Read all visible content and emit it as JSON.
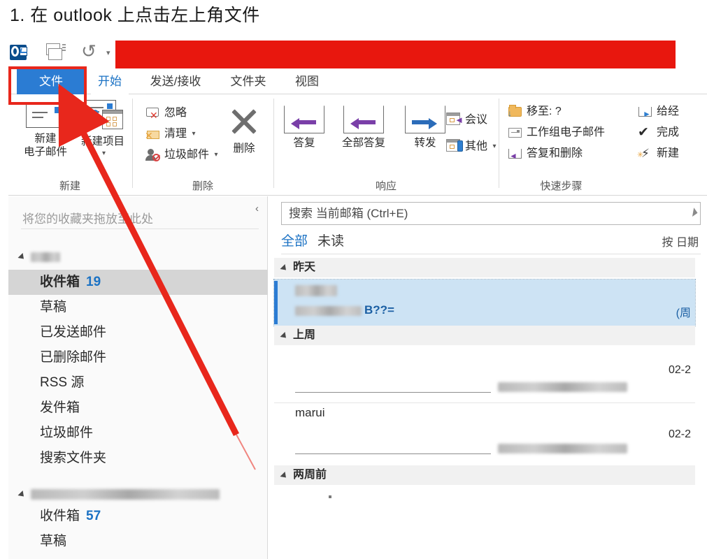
{
  "instruction": {
    "text": "1. 在 outlook 上点击左上角文件"
  },
  "quick_access": {
    "logo": "outlook-logo",
    "send_receive": "send-receive-all-icon",
    "undo": "↺",
    "dropdown": "▾"
  },
  "tabs": [
    {
      "label": "文件",
      "active": false,
      "highlighted": true
    },
    {
      "label": "开始",
      "active": true,
      "highlighted": false
    },
    {
      "label": "发送/接收",
      "active": false,
      "highlighted": false
    },
    {
      "label": "文件夹",
      "active": false,
      "highlighted": false
    },
    {
      "label": "视图",
      "active": false,
      "highlighted": false
    }
  ],
  "ribbon": {
    "groups": [
      {
        "name": "新建",
        "label": "新建",
        "buttons": [
          {
            "label_line1": "新建",
            "label_line2": "电子邮件",
            "icon": "new-email-icon"
          },
          {
            "label_line1": "新建项目",
            "label_line2": "",
            "icon": "new-item-icon",
            "has_caret": true
          }
        ]
      },
      {
        "name": "删除",
        "label": "删除",
        "small_buttons": [
          {
            "label": "忽略",
            "icon": "ignore-icon",
            "caret": false
          },
          {
            "label": "清理",
            "icon": "cleanup-icon",
            "caret": true
          },
          {
            "label": "垃圾邮件",
            "icon": "junk-icon",
            "caret": true
          }
        ],
        "buttons": [
          {
            "label_line1": "删除",
            "label_line2": "",
            "icon": "delete-x-icon"
          }
        ]
      },
      {
        "name": "响应",
        "label": "响应",
        "buttons": [
          {
            "label_line1": "答复",
            "label_line2": "",
            "icon": "reply-icon"
          },
          {
            "label_line1": "全部答复",
            "label_line2": "",
            "icon": "reply-all-icon"
          },
          {
            "label_line1": "转发",
            "label_line2": "",
            "icon": "forward-icon"
          }
        ],
        "small_buttons": [
          {
            "label": "会议",
            "icon": "meeting-icon",
            "caret": false
          },
          {
            "label": "其他",
            "icon": "more-icon",
            "caret": true
          }
        ]
      },
      {
        "name": "快速步骤",
        "label": "快速步骤",
        "quick_steps_col1": [
          {
            "label": "移至: ?",
            "icon": "move-to-folder-icon"
          },
          {
            "label": "工作组电子邮件",
            "icon": "team-email-icon"
          },
          {
            "label": "答复和删除",
            "icon": "reply-and-delete-icon"
          }
        ],
        "quick_steps_col2": [
          {
            "label": "给经",
            "icon": "to-manager-icon"
          },
          {
            "label": "完成",
            "icon": "done-check-icon"
          },
          {
            "label": "新建",
            "icon": "new-quickstep-icon"
          }
        ]
      }
    ]
  },
  "nav": {
    "favorites_placeholder": "将您的收藏夹拖放至此处",
    "collapse_icon": "‹",
    "accounts": [
      {
        "name_redacted": true,
        "name_width": 42,
        "folders": [
          {
            "label": "收件箱",
            "count": "19",
            "selected": true
          },
          {
            "label": "草稿",
            "count": "",
            "selected": false
          },
          {
            "label": "已发送邮件",
            "count": "",
            "selected": false
          },
          {
            "label": "已删除邮件",
            "count": "",
            "selected": false
          },
          {
            "label": "RSS 源",
            "count": "",
            "selected": false
          },
          {
            "label": "发件箱",
            "count": "",
            "selected": false
          },
          {
            "label": "垃圾邮件",
            "count": "",
            "selected": false
          },
          {
            "label": "搜索文件夹",
            "count": "",
            "selected": false
          }
        ]
      },
      {
        "name_redacted": true,
        "name_width": 270,
        "folders": [
          {
            "label": "收件箱",
            "count": "57",
            "selected": false
          },
          {
            "label": "草稿",
            "count": "",
            "selected": false
          }
        ]
      }
    ]
  },
  "mail_list": {
    "search_placeholder": "搜索 当前邮箱 (Ctrl+E)",
    "filter_all": "全部",
    "filter_unread": "未读",
    "sort_by": "按 日期",
    "groups": [
      {
        "label": "昨天",
        "messages": [
          {
            "sender": "",
            "sender_redacted": true,
            "subject": "B??=",
            "subject_redacted_prefix": true,
            "date": "(周",
            "selected": true
          }
        ]
      },
      {
        "label": "上周",
        "messages": [
          {
            "sender": "",
            "sender_redacted": false,
            "subject": "",
            "address_redacted": true,
            "date": "02-2",
            "selected": false
          },
          {
            "sender": "marui",
            "sender_redacted": false,
            "subject": "",
            "address_redacted": true,
            "date": "02-2",
            "selected": false
          }
        ]
      },
      {
        "label": "两周前",
        "messages": []
      }
    ]
  },
  "annotations": {
    "highlight_box": "红色方框 - 文件选项卡",
    "arrow": "红色箭头指向文件选项卡",
    "color": "#e8271c"
  },
  "colors": {
    "title_bar": "#e8170e",
    "file_tab": "#2b7cd3",
    "accent_blue": "#1b72c4",
    "selected_row": "#cde3f4",
    "annotation_red": "#e8271c"
  }
}
